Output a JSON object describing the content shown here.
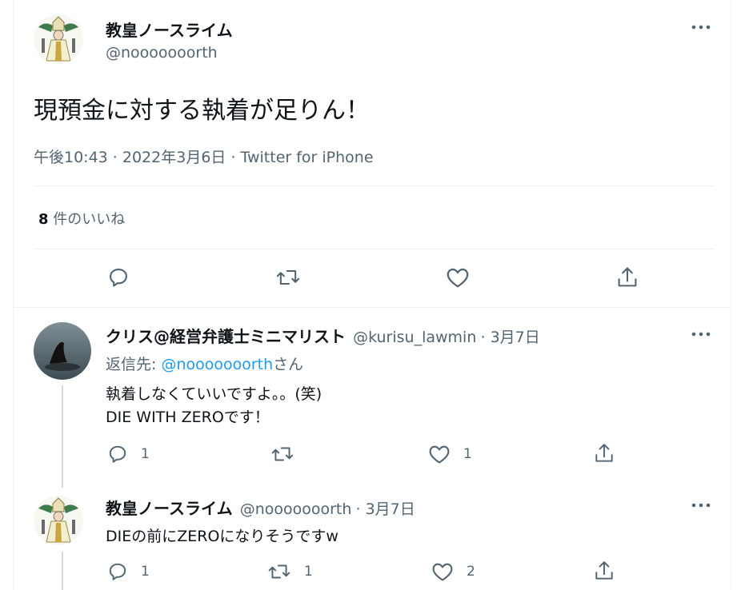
{
  "main_tweet": {
    "display_name": "教皇ノースライム",
    "handle": "@nooooooorth",
    "text": "現預金に対する執着が足りん！",
    "meta": "午後10:43 · 2022年3月6日 · Twitter for iPhone",
    "likes_count": "8",
    "likes_label": "件のいいね",
    "avatar_icon": "pope-character-icon"
  },
  "replies": [
    {
      "display_name": "クリス@経営弁護士ミニマリスト",
      "handle": "@kurisu_lawmin",
      "date": "· 3月7日",
      "reply_to_prefix": "返信先: ",
      "reply_to_handle": "@nooooooorth",
      "reply_to_suffix": "さん",
      "text_line1": "執着しなくていいですよ。。(笑)",
      "text_line2": "DIE WITH ZEROです！",
      "reply_count": "1",
      "retweet_count": "",
      "like_count": "1",
      "avatar_icon": "orca-photo-icon"
    },
    {
      "display_name": "教皇ノースライム",
      "handle": "@nooooooorth",
      "date": "· 3月7日",
      "text_line1": "DIEの前にZEROになりそうですw",
      "reply_count": "1",
      "retweet_count": "1",
      "like_count": "2",
      "avatar_icon": "pope-character-icon"
    }
  ],
  "colors": {
    "link": "#1d9bf0",
    "secondary": "#536471",
    "text": "#0f1419"
  }
}
